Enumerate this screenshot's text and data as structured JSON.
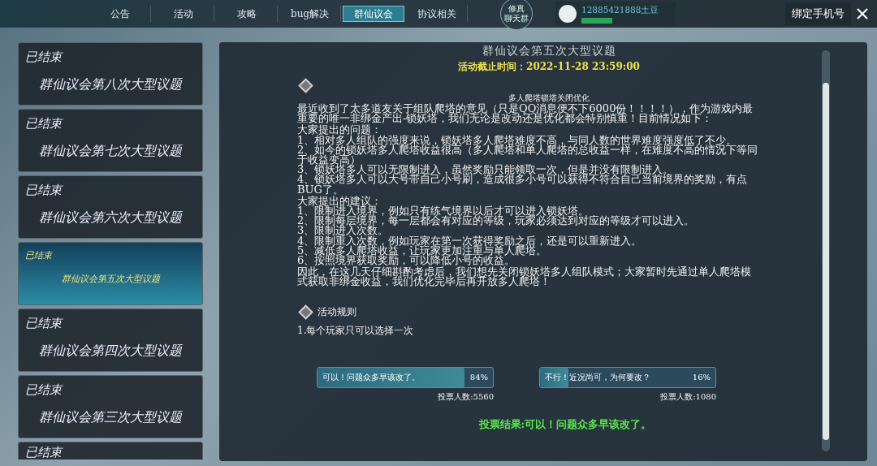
{
  "nav": {
    "tabs": [
      {
        "label": "公告",
        "selected": false
      },
      {
        "label": "活动",
        "selected": false
      },
      {
        "label": "攻略",
        "selected": false
      },
      {
        "label": "bug解决",
        "selected": false
      },
      {
        "label": "群仙议会",
        "selected": true
      },
      {
        "label": "协议相关",
        "selected": false
      }
    ],
    "chat_button": [
      "修真",
      "聊天群"
    ],
    "username": "12885421888土豆",
    "bind_button": "绑定手机号"
  },
  "sidebar": {
    "items": [
      {
        "status": "已结束",
        "title": "群仙议会第八次大型议题",
        "selected": false
      },
      {
        "status": "已结束",
        "title": "群仙议会第七次大型议题",
        "selected": false
      },
      {
        "status": "已结束",
        "title": "群仙议会第六次大型议题",
        "selected": false
      },
      {
        "status": "已结束",
        "title": "群仙议会第五次大型议题",
        "selected": true
      },
      {
        "status": "已结束",
        "title": "群仙议会第四次大型议题",
        "selected": false
      },
      {
        "status": "已结束",
        "title": "群仙议会第三次大型议题",
        "selected": false
      },
      {
        "status": "已结束",
        "selected": false
      }
    ]
  },
  "content": {
    "title": "群仙议会第五次大型议题",
    "deadline": "活动截止时间：2022-11-28 23:59:00",
    "subtitle": "多人爬塔锁塔关闭优化",
    "paragraphs": [
      "最近收到了太多道友关于组队爬塔的意见（只是QQ消息便不下6000份！！！！），作为游戏内最重要的唯一非绑金产出-锁妖塔，我们无论是改动还是优化都会特别慎重！目前情况如下：",
      "大家提出的问题：\n1、相对多人组队的强度来说，锁妖塔多人爬塔难度不高，与同人数的世界难度强度低了不少。\n2、如今的锁妖塔多人爬塔收益很高（多人爬塔和单人爬塔的总收益一样，在难度不高的情况下等同于收益变高）\n3、锁妖塔多人可以无限制进入，虽然奖励只能领取一次，但是并没有限制进入。\n4、锁妖塔多人可以大号带自己小号刷，造成很多小号可以获得不符合自己当前境界的奖励，有点BUG了。",
      "大家提出的建议：\n1、限制进入境界，例如只有练气境界以后才可以进入锁妖塔。\n2、限制每层境界，每一层都会有对应的等级，玩家必须达到对应的等级才可以进入。\n3、限制进入次数。\n4、限制重入次数，例如玩家在第一次获得奖励之后，还是可以重新进入。\n5、减低多人爬塔收益，让玩家更加注重与单人爬塔。\n6、按照境界获取奖励，可以降低小号的收益。",
      "因此，在这几天仔细斟酌考虑后，我们想先关闭锁妖塔多人组队模式；大家暂时先通过单人爬塔模式获取非绑金收益，我们优化完毕后再开放多人爬塔！"
    ],
    "rules_heading": "活动规则",
    "rules": "1.每个玩家只可以选择一次",
    "options": [
      {
        "label": "可以！问题众多早该改了。",
        "percent": "84%",
        "level": 0.84,
        "votes": "投票人数:5560"
      },
      {
        "label": "不行！近况尚可，为何要改？",
        "percent": "16%",
        "level": 0.16,
        "votes": "投票人数:1080"
      }
    ],
    "result": "投票结果:可以！问题众多早该改了。"
  }
}
